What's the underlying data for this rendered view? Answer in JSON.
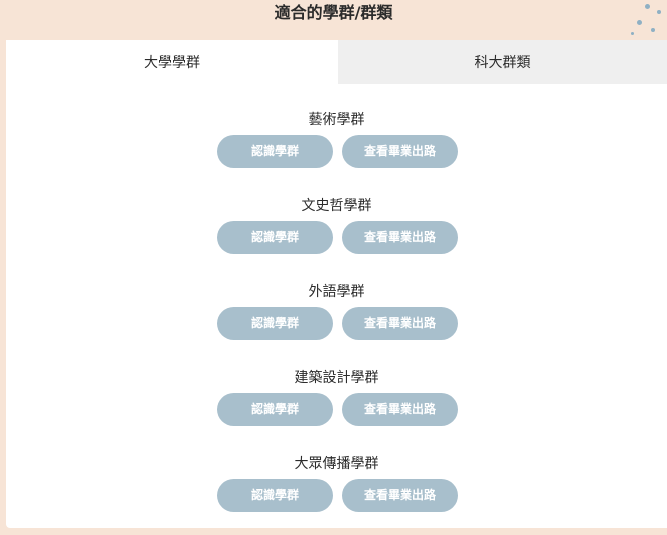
{
  "header": {
    "title": "適合的學群/群類"
  },
  "tabs": [
    {
      "label": "大學學群",
      "active": true
    },
    {
      "label": "科大群類",
      "active": false
    }
  ],
  "groups": [
    {
      "title": "藝術學群",
      "intro_label": "認識學群",
      "career_label": "查看畢業出路"
    },
    {
      "title": "文史哲學群",
      "intro_label": "認識學群",
      "career_label": "查看畢業出路"
    },
    {
      "title": "外語學群",
      "intro_label": "認識學群",
      "career_label": "查看畢業出路"
    },
    {
      "title": "建築設計學群",
      "intro_label": "認識學群",
      "career_label": "查看畢業出路"
    },
    {
      "title": "大眾傳播學群",
      "intro_label": "認識學群",
      "career_label": "查看畢業出路"
    }
  ],
  "colors": {
    "background": "#f7e4d6",
    "button": "#a8bfcc",
    "inactive_tab": "#efefef",
    "decor_dots": "#8fb0c4"
  }
}
